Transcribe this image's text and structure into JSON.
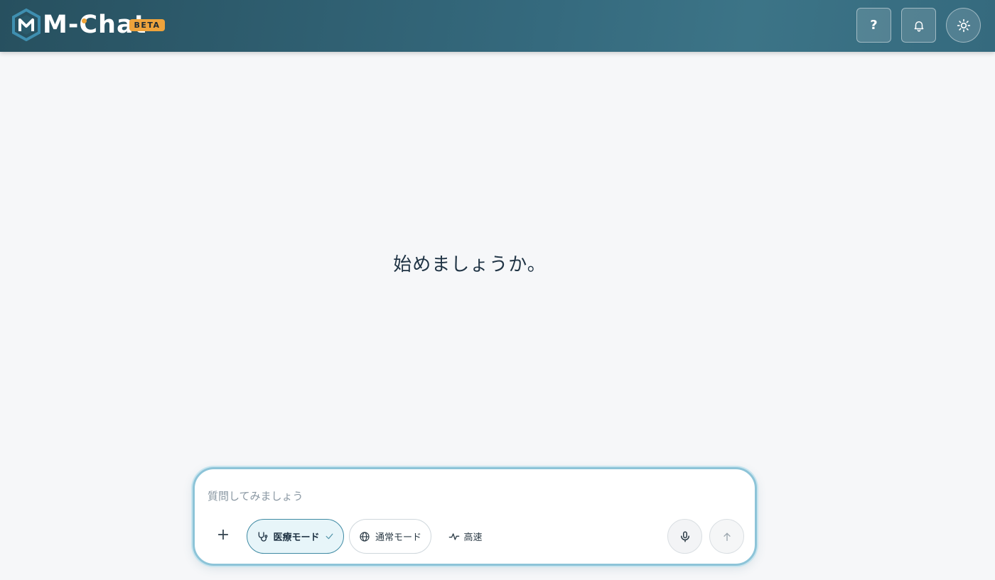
{
  "header": {
    "logo_text": "M-Chat",
    "badge": "BETA",
    "help_label": "?",
    "icons": {
      "logo": "m-chat-logo",
      "bell": "bell-icon",
      "theme": "sun-icon"
    }
  },
  "main": {
    "greeting": "始めましょうか。"
  },
  "composer": {
    "placeholder": "質問してみましょう",
    "plus_label": "+",
    "modes": {
      "medical": {
        "label": "医療モード",
        "icon": "stethoscope-icon",
        "selected": true
      },
      "normal": {
        "label": "通常モード",
        "icon": "globe-icon",
        "selected": false
      },
      "fast": {
        "label": "高速",
        "icon": "pulse-icon"
      }
    },
    "icons": {
      "mic": "microphone-icon",
      "send": "arrow-up-icon",
      "check": "check-icon"
    }
  },
  "colors": {
    "header_start": "#27505f",
    "header_end": "#3c7487",
    "accent": "#eea33c",
    "composer_border": "#8dc4d8",
    "chip_selected_bg": "#e7f5f9"
  }
}
